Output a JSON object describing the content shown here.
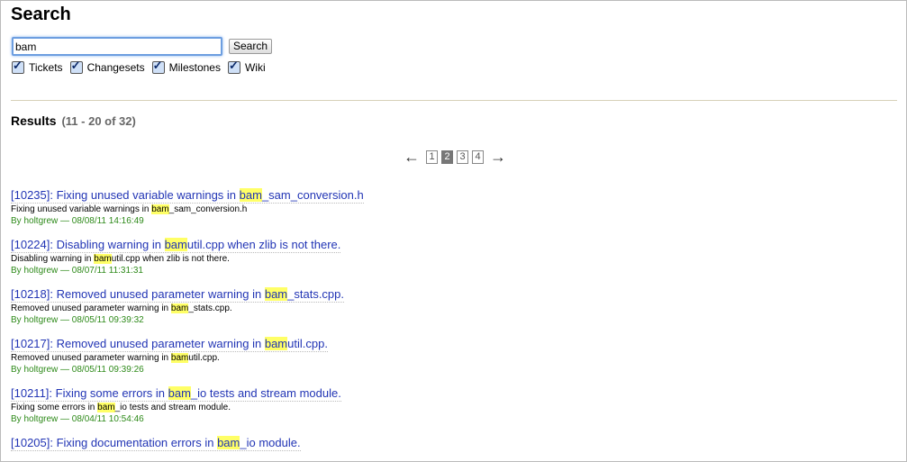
{
  "page": {
    "title": "Search"
  },
  "search": {
    "value": "bam",
    "button_label": "Search"
  },
  "filters": [
    {
      "label": "Tickets",
      "checked": true
    },
    {
      "label": "Changesets",
      "checked": true
    },
    {
      "label": "Milestones",
      "checked": true
    },
    {
      "label": "Wiki",
      "checked": true
    }
  ],
  "results_header": {
    "label": "Results",
    "count": "(11 - 20 of 32)"
  },
  "pager": {
    "prev": "←",
    "next": "→",
    "pages": [
      "1",
      "2",
      "3",
      "4"
    ],
    "current": "2"
  },
  "results": [
    {
      "title_pre": "[10235]: Fixing unused variable warnings in ",
      "title_hl": "bam",
      "title_post": "_sam_conversion.h",
      "excerpt_pre": "Fixing unused variable warnings in ",
      "excerpt_hl": "bam",
      "excerpt_post": "_sam_conversion.h",
      "meta": "By holtgrew — 08/08/11 14:16:49"
    },
    {
      "title_pre": "[10224]: Disabling warning in ",
      "title_hl": "bam",
      "title_post": "util.cpp when zlib is not there.",
      "excerpt_pre": "Disabling warning in ",
      "excerpt_hl": "bam",
      "excerpt_post": "util.cpp when zlib is not there.",
      "meta": "By holtgrew — 08/07/11 11:31:31"
    },
    {
      "title_pre": "[10218]: Removed unused parameter warning in ",
      "title_hl": "bam",
      "title_post": "_stats.cpp.",
      "excerpt_pre": "Removed unused parameter warning in ",
      "excerpt_hl": "bam",
      "excerpt_post": "_stats.cpp.",
      "meta": "By holtgrew — 08/05/11 09:39:32"
    },
    {
      "title_pre": "[10217]: Removed unused parameter warning in ",
      "title_hl": "bam",
      "title_post": "util.cpp.",
      "excerpt_pre": "Removed unused parameter warning in ",
      "excerpt_hl": "bam",
      "excerpt_post": "util.cpp.",
      "meta": "By holtgrew — 08/05/11 09:39:26"
    },
    {
      "title_pre": "[10211]: Fixing some errors in ",
      "title_hl": "bam",
      "title_post": "_io tests and stream module.",
      "excerpt_pre": "Fixing some errors in ",
      "excerpt_hl": "bam",
      "excerpt_post": "_io tests and stream module.",
      "meta": "By holtgrew — 08/04/11 10:54:46"
    },
    {
      "title_pre": "[10205]: Fixing documentation errors in ",
      "title_hl": "bam",
      "title_post": "_io module.",
      "excerpt_pre": "",
      "excerpt_hl": "",
      "excerpt_post": "",
      "meta": ""
    }
  ]
}
